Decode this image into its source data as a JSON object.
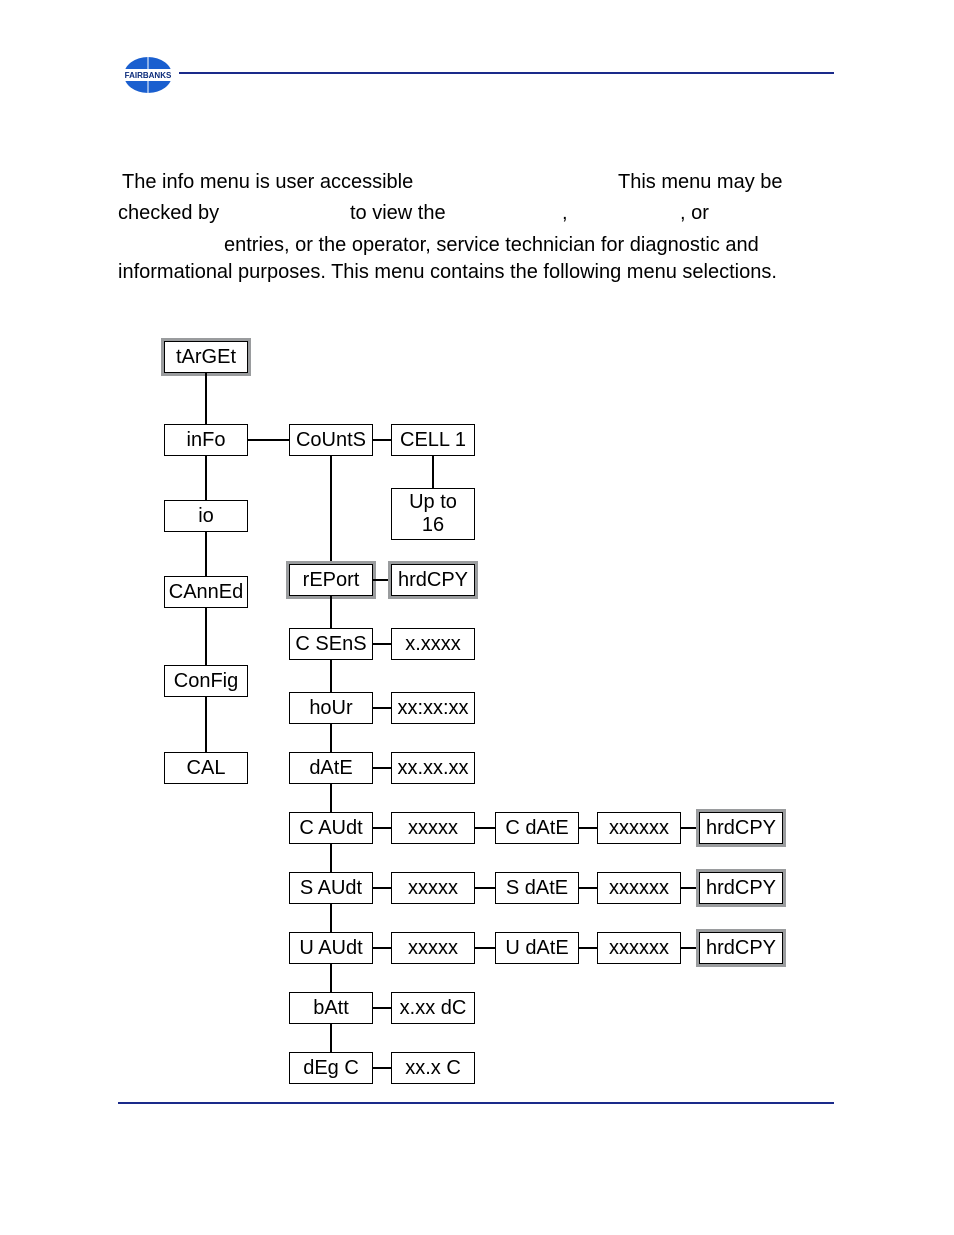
{
  "text": {
    "l1a": "The info menu is user accessible",
    "l1b": "This menu may be",
    "l2a": "checked by",
    "l2b": "to view the",
    "l2c": ",",
    "l2d": ", or",
    "l3": "entries, or the operator, service technician for diagnostic and",
    "l4": "informational purposes. This menu contains the following menu selections."
  },
  "nodes": {
    "target": "tArGEt",
    "info": "inFo",
    "io": "io",
    "canned": "CAnnEd",
    "config": "ConFig",
    "cal": "CAL",
    "counts": "CoUntS",
    "cell1": "CELL 1",
    "upto16": "Up to 16",
    "report": "rEPort",
    "hrdcpy_a": "hrdCPY",
    "csens": "C SEnS",
    "v_csens": "x.xxxx",
    "hour": "hoUr",
    "v_hour": "xx:xx:xx",
    "date": "dAtE",
    "v_date": "xx.xx.xx",
    "caudt": "C AUdt",
    "v_caudt": "xxxxx",
    "cdate": "C dAtE",
    "v_cdate": "xxxxxx",
    "hrdcpy_c": "hrdCPY",
    "saudt": "S AUdt",
    "v_saudt": "xxxxx",
    "sdate": "S dAtE",
    "v_sdate": "xxxxxx",
    "hrdcpy_s": "hrdCPY",
    "uaudt": "U AUdt",
    "v_uaudt": "xxxxx",
    "udate": "U dAtE",
    "v_udate": "xxxxxx",
    "hrdcpy_u": "hrdCPY",
    "batt": "bAtt",
    "v_batt": "x.xx dC",
    "degc": "dEg C",
    "v_degc": "xx.x C"
  }
}
